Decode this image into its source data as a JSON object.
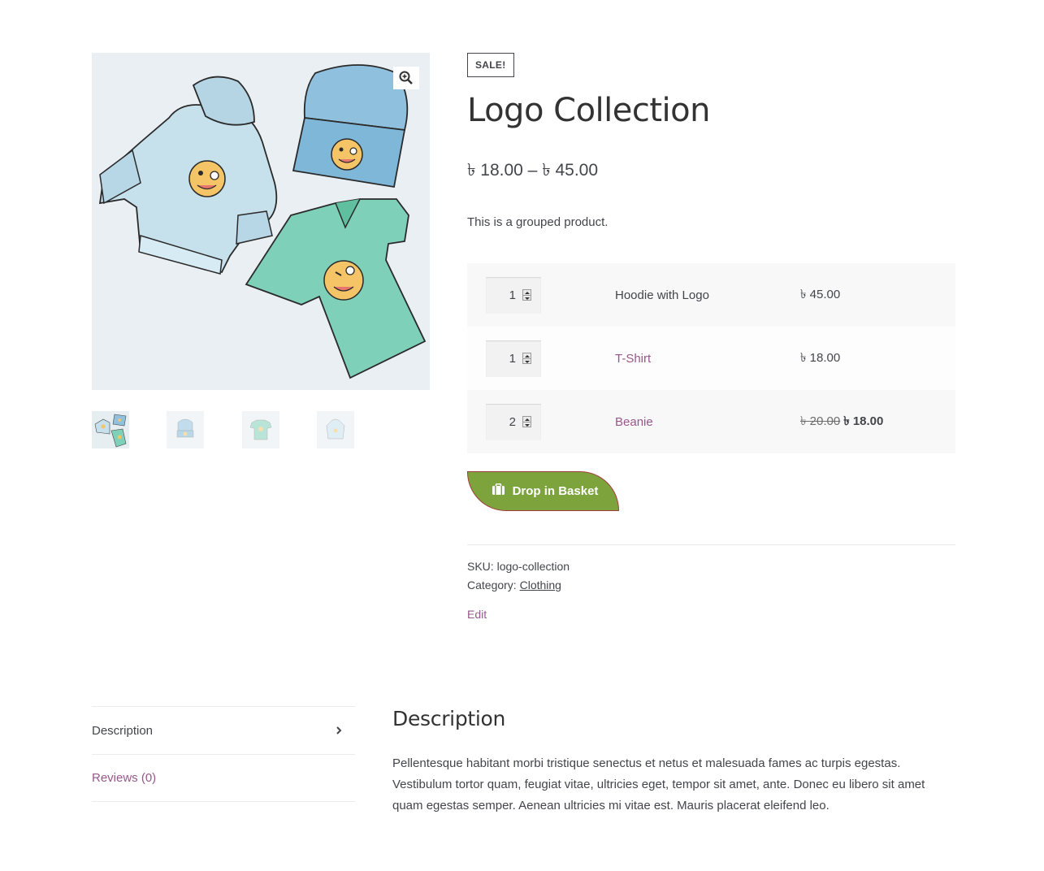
{
  "product": {
    "sale_badge": "SALE!",
    "title": "Logo Collection",
    "price_range": "৳ 18.00 – ৳ 45.00",
    "short_description": "This is a grouped product.",
    "zoom_icon": "zoom-in-icon"
  },
  "gallery": {
    "thumbnails": [
      "logo-collection",
      "beanie",
      "t-shirt",
      "hoodie"
    ]
  },
  "grouped_items": [
    {
      "qty": "1",
      "name": "Hoodie with Logo",
      "price": "৳ 45.00",
      "regular_price": "",
      "linked": false
    },
    {
      "qty": "1",
      "name": "T-Shirt",
      "price": "৳ 18.00",
      "regular_price": "",
      "linked": true
    },
    {
      "qty": "2",
      "name": "Beanie",
      "price": "৳ 18.00",
      "regular_price": "৳ 20.00",
      "linked": true
    }
  ],
  "cart": {
    "button_label": "Drop in Basket",
    "button_icon": "shopping-bag-icon",
    "button_color": "#7da33c"
  },
  "meta": {
    "sku_label": "SKU:",
    "sku": "logo-collection",
    "category_label": "Category:",
    "category": "Clothing",
    "edit_label": "Edit"
  },
  "tabs": {
    "items": [
      {
        "label": "Description",
        "active": true
      },
      {
        "label": "Reviews (0)",
        "active": false
      }
    ],
    "panel_title": "Description",
    "panel_text": "Pellentesque habitant morbi tristique senectus et netus et malesuada fames ac turpis egestas. Vestibulum tortor quam, feugiat vitae, ultricies eget, tempor sit amet, ante. Donec eu libero sit amet quam egestas semper. Aenean ultricies mi vitae est. Mauris placerat eleifend leo."
  },
  "colors": {
    "link": "#96588a",
    "text": "#43454b",
    "accent_button": "#7da33c"
  }
}
